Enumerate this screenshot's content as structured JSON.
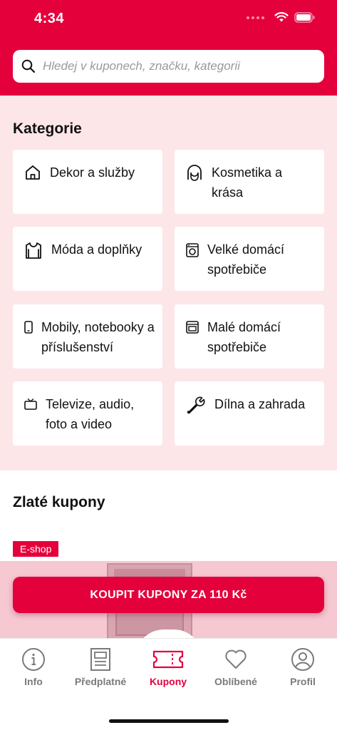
{
  "status_bar": {
    "time": "4:34",
    "icons": [
      "signal-dots-icon",
      "wifi-icon",
      "battery-icon"
    ]
  },
  "search": {
    "placeholder": "Hledej v kuponech, značku, kategorii",
    "value": "",
    "icon": "search-icon"
  },
  "categories": {
    "title": "Kategorie",
    "items": [
      {
        "label": "Dekor a služby",
        "icon": "house-icon"
      },
      {
        "label": "Kosmetika a krása",
        "icon": "face-icon"
      },
      {
        "label": "Móda a doplňky",
        "icon": "shirt-icon"
      },
      {
        "label": "Velké domácí spotřebiče",
        "icon": "washing-machine-icon"
      },
      {
        "label": "Mobily, notebooky a příslušenství",
        "icon": "phone-icon"
      },
      {
        "label": "Malé domácí spotřebiče",
        "icon": "microwave-icon"
      },
      {
        "label": "Televize, audio, foto a video",
        "icon": "tv-icon"
      },
      {
        "label": "Dílna a zahrada",
        "icon": "wrench-icon"
      }
    ]
  },
  "golden_coupons": {
    "title": "Zlaté kupony",
    "badge": "E-shop"
  },
  "buy_button": {
    "label": "KOUPIT KUPONY ZA 110 Kč"
  },
  "tabbar": {
    "active": "Kupony",
    "tabs": [
      {
        "label": "Info",
        "icon": "info-icon"
      },
      {
        "label": "Předplatné",
        "icon": "newspaper-icon"
      },
      {
        "label": "Kupony",
        "icon": "ticket-icon"
      },
      {
        "label": "Oblíbené",
        "icon": "heart-icon"
      },
      {
        "label": "Profil",
        "icon": "profile-icon"
      }
    ]
  },
  "colors": {
    "accent": "#e4003b",
    "category_background": "#fde6e8",
    "inactive_tab": "#7a7a7a"
  }
}
